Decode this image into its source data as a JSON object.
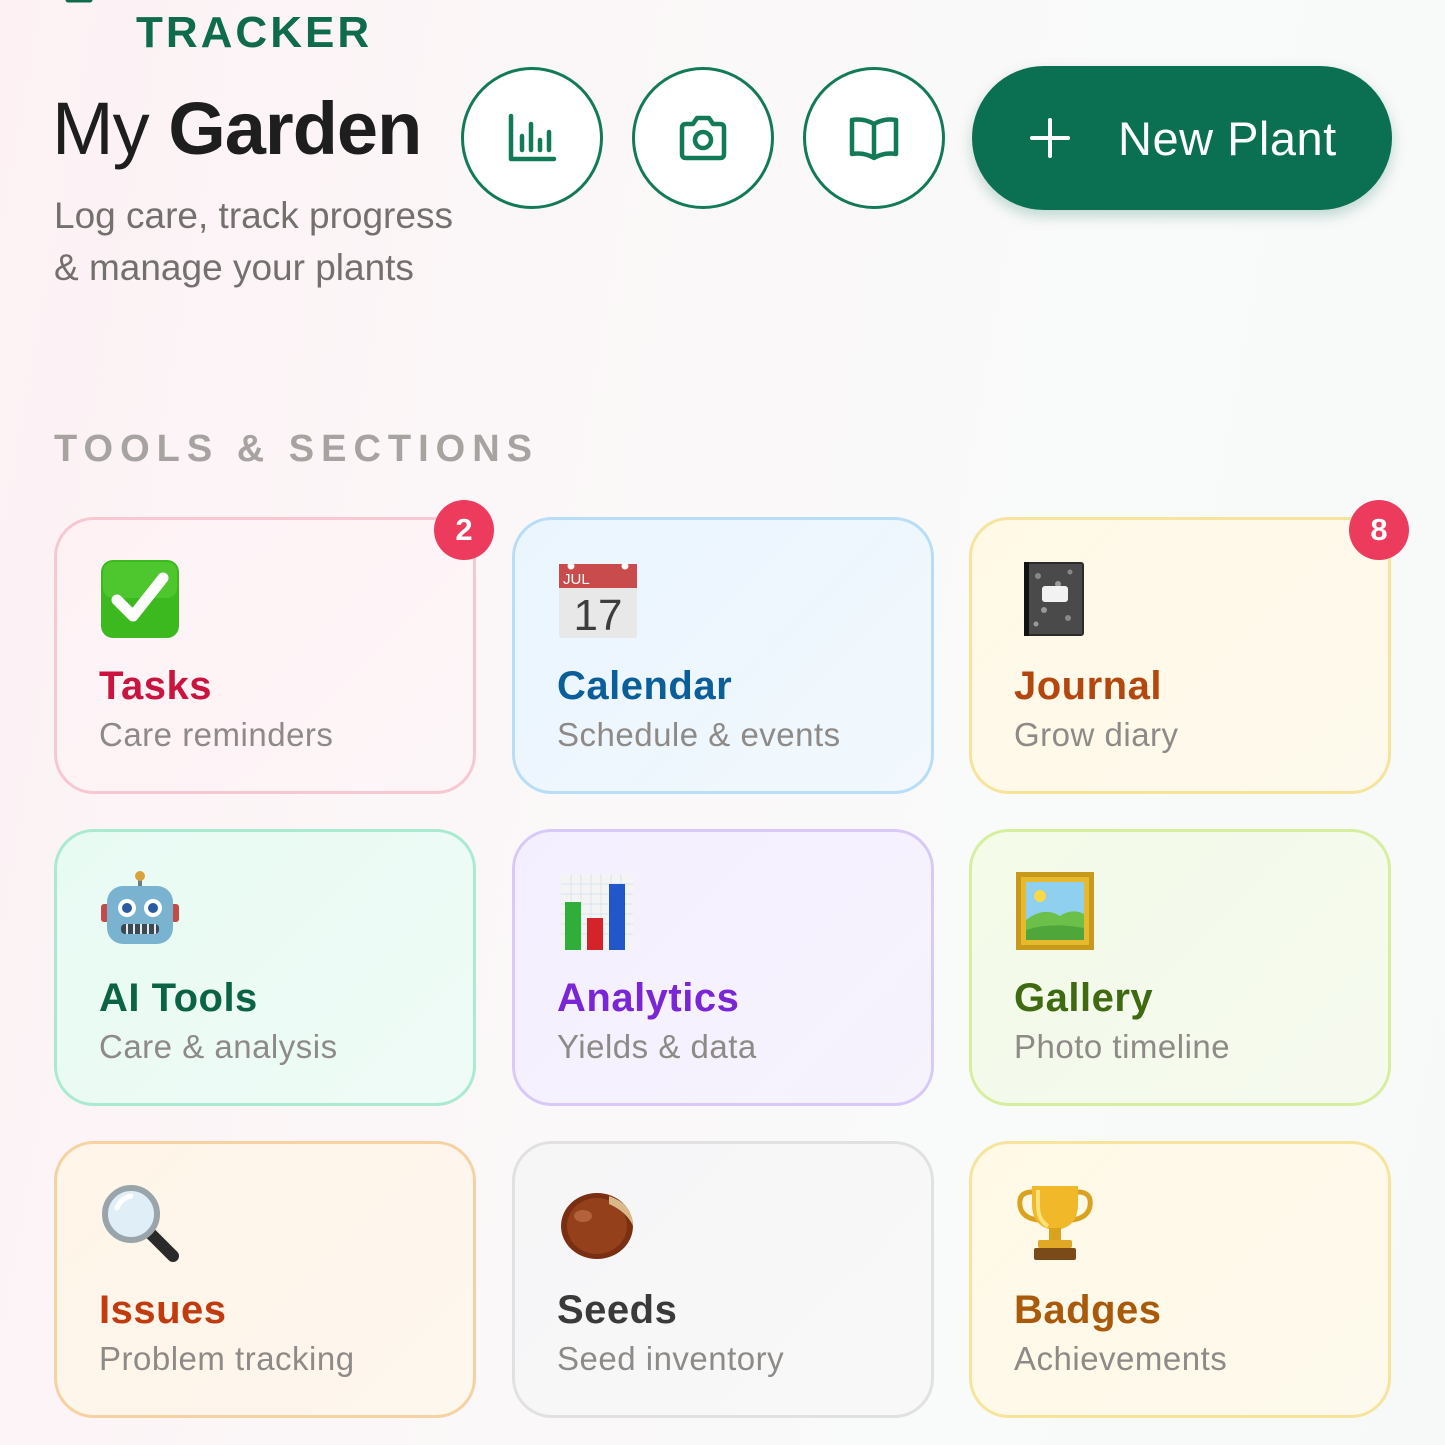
{
  "header": {
    "brand_text": "TRACKER",
    "title_light": "My",
    "title_bold": "Garden",
    "subtitle": "Log care, track progress & manage your plants",
    "actions": {
      "analytics_icon": "bar-chart-icon",
      "camera_icon": "camera-icon",
      "journal_icon": "book-icon",
      "new_plant_label": "New Plant",
      "new_plant_icon": "plus-icon"
    }
  },
  "tools": {
    "heading": "TOOLS & SECTIONS",
    "items": [
      {
        "title": "Tasks",
        "subtitle": "Care reminders",
        "icon": "check-mark-emoji",
        "badge": "2",
        "title_color": "#c8143f"
      },
      {
        "title": "Calendar",
        "subtitle": "Schedule & events",
        "icon": "calendar-emoji",
        "calendar_month": "JUL",
        "calendar_day": "17",
        "title_color": "#0a5f9a"
      },
      {
        "title": "Journal",
        "subtitle": "Grow diary",
        "icon": "notebook-emoji",
        "badge": "8",
        "title_color": "#b3470d"
      },
      {
        "title": "AI Tools",
        "subtitle": "Care & analysis",
        "icon": "robot-emoji",
        "title_color": "#0b6346"
      },
      {
        "title": "Analytics",
        "subtitle": "Yields & data",
        "icon": "bar-chart-emoji",
        "title_color": "#7a26d6"
      },
      {
        "title": "Gallery",
        "subtitle": "Photo timeline",
        "icon": "framed-picture-emoji",
        "title_color": "#3f6a12"
      },
      {
        "title": "Issues",
        "subtitle": "Problem tracking",
        "icon": "magnifying-glass-emoji",
        "title_color": "#c23b0e"
      },
      {
        "title": "Seeds",
        "subtitle": "Seed inventory",
        "icon": "chestnut-emoji",
        "title_color": "#3a3a3a"
      },
      {
        "title": "Badges",
        "subtitle": "Achievements",
        "icon": "trophy-emoji",
        "title_color": "#a9590a"
      }
    ]
  },
  "colors": {
    "brand_green": "#0b7052",
    "badge_red": "#ec3b5c"
  }
}
